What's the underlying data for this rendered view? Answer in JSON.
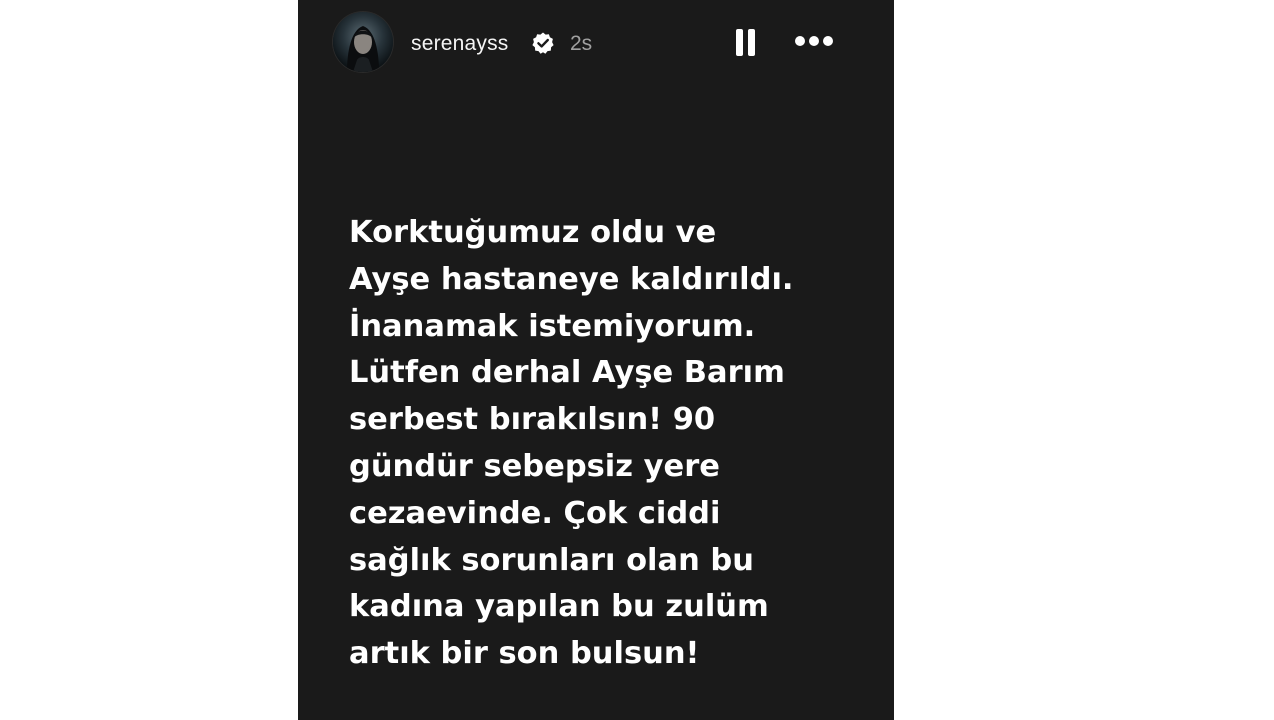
{
  "story": {
    "username": "serenayss",
    "timestamp": "2s",
    "verified_icon": "verified-badge-icon",
    "pause_icon": "pause-icon",
    "more_icon": "more-options-icon",
    "text": "Korktuğumuz oldu ve\nAyşe hastaneye kaldırıldı.\nİnanamak istemiyorum.\nLütfen derhal Ayşe Barım\nserbest bırakılsın!  90\ngündür sebepsiz yere\ncezaevinde. Çok ciddi\nsağlık sorunları olan bu\nkadına yapılan bu zulüm\nartık bir son bulsun!",
    "background_color": "#1a1a1a",
    "text_color": "#ffffff"
  }
}
